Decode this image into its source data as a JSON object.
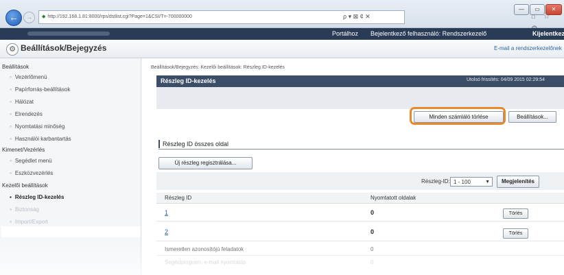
{
  "browser": {
    "address": "http://192.168.1.81:8000/rps/dstlist.cgi?Page=1&CSI/T=-700000000",
    "address_icons": "ρ ▾ ⊠ ¢ ✕",
    "window_buttons": [
      "—",
      "▭",
      "✕"
    ],
    "toolbar_icons": "⌂ ☆ ⚙"
  },
  "topnav": {
    "portal": "Portálhoz",
    "user_left": "Bejelentkező felhasználó: Rendszerkezelő",
    "logout": "Kijelentkezé"
  },
  "header": {
    "title": "Beállítások/Bejegyzés",
    "email_link": "E-mail a rendszerkezelőnek"
  },
  "sidebar": {
    "sections": [
      {
        "title": "Beállítások",
        "items": [
          "Vezérlőmenü",
          "Papírforrás-beállítások",
          "Hálózat",
          "Elrendezés",
          "Nyomtatási minőség",
          "Használói karbantartás"
        ]
      },
      {
        "title": "Kimenet/Vezérlés",
        "items": [
          "Segédlet menü",
          "Eszközvezérlés"
        ]
      },
      {
        "title": "Kezelői beállítások",
        "items": [
          "Részleg ID-kezelés",
          "Biztonság",
          "Import/Export"
        ]
      }
    ]
  },
  "main": {
    "breadcrumb": "Beállítások/Bejegyzés: Kezelői beállítások: Részleg ID-kezelés",
    "panel_title": "Részleg ID-kezelés",
    "last_update": "Utolsó frissítés: 04/09 2015 02:29:54",
    "reset_button": "Minden számláló törlése",
    "settings_button": "Beállítások...",
    "section_title": "Részleg ID összes oldal",
    "register_button": "Új részleg regisztrálása...",
    "filter_label": "Részleg-ID:",
    "filter_value": "1 - 100",
    "show_button": "Megjelenítés",
    "columns": [
      "Részleg ID",
      "Nyomtatott oldalak"
    ],
    "rows": [
      {
        "id": "1",
        "pages": "0",
        "action": "Törlés"
      },
      {
        "id": "2",
        "pages": "0",
        "action": "Törlés"
      }
    ],
    "extra_rows": [
      {
        "label": "Ismeretlen azonosítójú feladatok",
        "value": "0"
      },
      {
        "label": "Segédprogram, e-mail nyomtatás",
        "value": "0"
      }
    ]
  }
}
